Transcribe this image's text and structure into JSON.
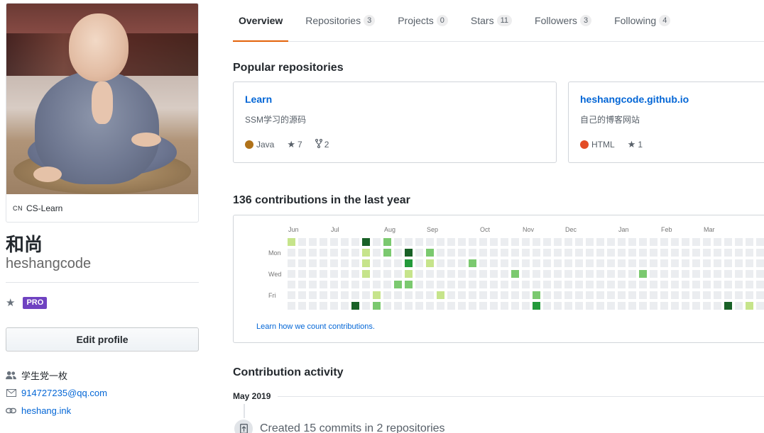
{
  "profile": {
    "org_prefix": "CN",
    "org_name": "CS-Learn",
    "name": "和尚",
    "login": "heshangcode",
    "pro_badge": "PRO",
    "edit_button": "Edit profile",
    "company": "学生党一枚",
    "email": "914727235@qq.com",
    "website": "heshang.ink"
  },
  "tabs": [
    {
      "label": "Overview",
      "count": null,
      "selected": true
    },
    {
      "label": "Repositories",
      "count": "3"
    },
    {
      "label": "Projects",
      "count": "0"
    },
    {
      "label": "Stars",
      "count": "11"
    },
    {
      "label": "Followers",
      "count": "3"
    },
    {
      "label": "Following",
      "count": "4"
    }
  ],
  "popular": {
    "title": "Popular repositories",
    "repos": [
      {
        "name": "Learn",
        "description": "SSM学习的源码",
        "language": "Java",
        "language_color": "#b07219",
        "stars": "7",
        "forks": "2"
      },
      {
        "name": "heshangcode.github.io",
        "description": "自己的博客网站",
        "language": "HTML",
        "language_color": "#e34c26",
        "stars": "1"
      }
    ]
  },
  "contributions": {
    "title": "136 contributions in the last year",
    "months": [
      "Jun",
      "Jul",
      "Aug",
      "Sep",
      "Oct",
      "Nov",
      "Dec",
      "Jan",
      "Feb",
      "Mar"
    ],
    "weekdays": [
      "Mon",
      "Wed",
      "Fri"
    ],
    "learn_link": "Learn how we count contributions.",
    "colors": [
      "#ebedf0",
      "#c6e48b",
      "#7bc96f",
      "#239a3b",
      "#196127"
    ],
    "active_cells": [
      {
        "week": 0,
        "day": 0,
        "level": 1
      },
      {
        "week": 7,
        "day": 0,
        "level": 4
      },
      {
        "week": 7,
        "day": 1,
        "level": 1
      },
      {
        "week": 7,
        "day": 2,
        "level": 1
      },
      {
        "week": 7,
        "day": 3,
        "level": 1
      },
      {
        "week": 6,
        "day": 6,
        "level": 4
      },
      {
        "week": 8,
        "day": 5,
        "level": 1
      },
      {
        "week": 8,
        "day": 6,
        "level": 2
      },
      {
        "week": 9,
        "day": 0,
        "level": 2
      },
      {
        "week": 9,
        "day": 1,
        "level": 2
      },
      {
        "week": 10,
        "day": 4,
        "level": 2
      },
      {
        "week": 11,
        "day": 1,
        "level": 4
      },
      {
        "week": 11,
        "day": 2,
        "level": 3
      },
      {
        "week": 11,
        "day": 3,
        "level": 1
      },
      {
        "week": 11,
        "day": 4,
        "level": 2
      },
      {
        "week": 13,
        "day": 1,
        "level": 2
      },
      {
        "week": 13,
        "day": 2,
        "level": 1
      },
      {
        "week": 14,
        "day": 5,
        "level": 1
      },
      {
        "week": 17,
        "day": 2,
        "level": 2
      },
      {
        "week": 21,
        "day": 3,
        "level": 2
      },
      {
        "week": 23,
        "day": 5,
        "level": 2
      },
      {
        "week": 23,
        "day": 6,
        "level": 3
      },
      {
        "week": 33,
        "day": 3,
        "level": 2
      },
      {
        "week": 41,
        "day": 6,
        "level": 4
      },
      {
        "week": 43,
        "day": 6,
        "level": 1
      }
    ]
  },
  "activity": {
    "title": "Contribution activity",
    "month": "May 2019",
    "event": "Created 15 commits in 2 repositories"
  }
}
